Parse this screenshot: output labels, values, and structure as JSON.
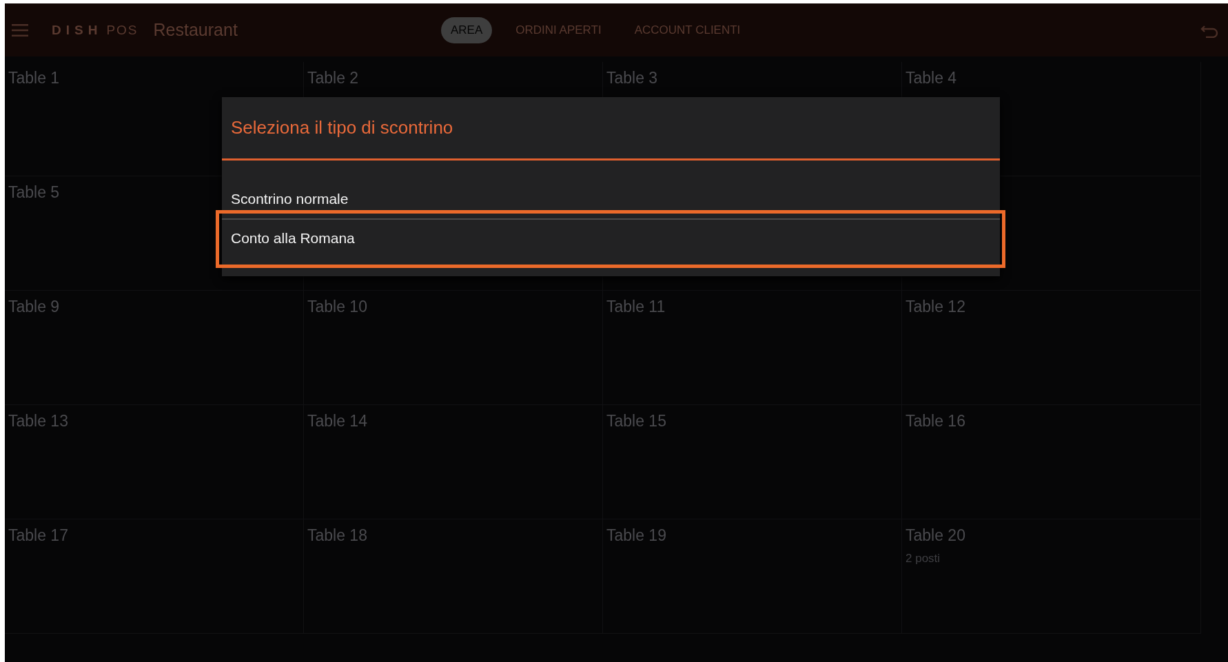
{
  "app_bar": {
    "brand": "DISH",
    "product": "POS",
    "title": "Restaurant",
    "tabs": [
      {
        "label": "AREA",
        "selected": true
      },
      {
        "label": "ORDINI APERTI",
        "selected": false
      },
      {
        "label": "ACCOUNT CLIENTI",
        "selected": false
      }
    ]
  },
  "table_rows": [
    [
      {
        "name": "Table 1"
      },
      {
        "name": "Table 2"
      },
      {
        "name": "Table 3"
      },
      {
        "name": "Table 4"
      }
    ],
    [
      {
        "name": "Table 5"
      }
    ],
    [
      {
        "name": "Table 9"
      },
      {
        "name": "Table 10"
      },
      {
        "name": "Table 11"
      },
      {
        "name": "Table 12"
      }
    ],
    [
      {
        "name": "Table 13"
      },
      {
        "name": "Table 14"
      },
      {
        "name": "Table 15"
      },
      {
        "name": "Table 16"
      }
    ],
    [
      {
        "name": "Table 17"
      },
      {
        "name": "Table 18"
      },
      {
        "name": "Table 19"
      },
      {
        "name": "Table 20",
        "seats": "2 posti"
      }
    ]
  ],
  "dialog": {
    "title": "Seleziona il tipo di scontrino",
    "items": [
      {
        "label": "Scontrino normale",
        "highlighted": false
      },
      {
        "label": "Conto alla Romana",
        "highlighted": true
      }
    ]
  }
}
